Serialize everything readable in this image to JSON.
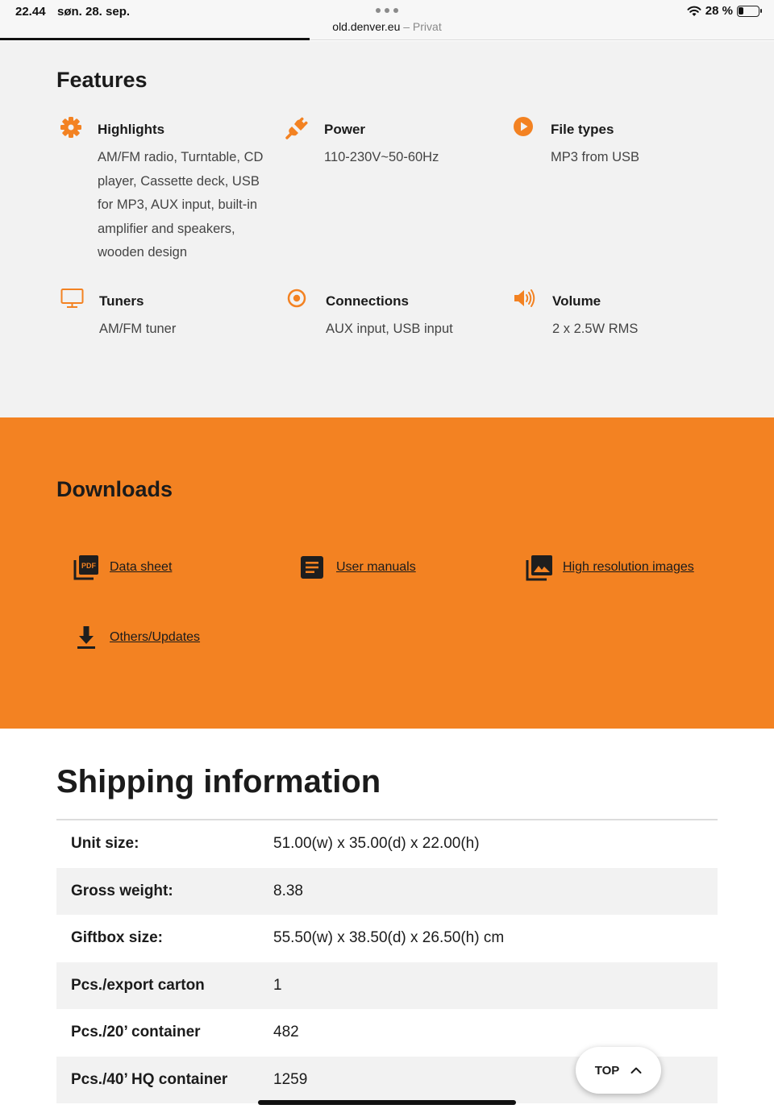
{
  "status_bar": {
    "time": "22.44",
    "date": "søn. 28. sep.",
    "url": "old.denver.eu",
    "url_suffix": " – Privat",
    "battery": "28 %",
    "battery_level": 0.28
  },
  "features": {
    "title": "Features",
    "accent_color": "#f38222",
    "items": [
      {
        "icon": "gear-icon",
        "title": "Highlights",
        "description": "AM/FM radio, Turntable, CD player, Cassette deck, USB for MP3, AUX input, built-in amplifier and speakers, wooden design"
      },
      {
        "icon": "plug-icon",
        "title": "Power",
        "description": "110-230V~50-60Hz"
      },
      {
        "icon": "play-circle-icon",
        "title": "File types",
        "description": "MP3 from USB"
      },
      {
        "icon": "monitor-icon",
        "title": "Tuners",
        "description": "AM/FM tuner"
      },
      {
        "icon": "target-icon",
        "title": "Connections",
        "description": "AUX input, USB input"
      },
      {
        "icon": "speaker-icon",
        "title": "Volume",
        "description": "2 x 2.5W RMS"
      }
    ]
  },
  "downloads": {
    "title": "Downloads",
    "background": "#f38222",
    "links": [
      {
        "icon": "pdf-icon",
        "label": "Data sheet"
      },
      {
        "icon": "document-icon",
        "label": "User manuals"
      },
      {
        "icon": "image-gallery-icon",
        "label": "High resolution images"
      },
      {
        "icon": "download-icon",
        "label": "Others/Updates"
      }
    ]
  },
  "shipping": {
    "title": "Shipping information",
    "rows": [
      {
        "label": "Unit size:",
        "value": "51.00(w) x 35.00(d) x 22.00(h)"
      },
      {
        "label": "Gross weight:",
        "value": "8.38"
      },
      {
        "label": "Giftbox size:",
        "value": "55.50(w) x 38.50(d) x 26.50(h) cm"
      },
      {
        "label": "Pcs./export carton",
        "value": "1"
      },
      {
        "label": "Pcs./20’ container",
        "value": "482"
      },
      {
        "label": "Pcs./40’ HQ container",
        "value": "1259"
      }
    ]
  },
  "top_button": {
    "label": "TOP"
  }
}
